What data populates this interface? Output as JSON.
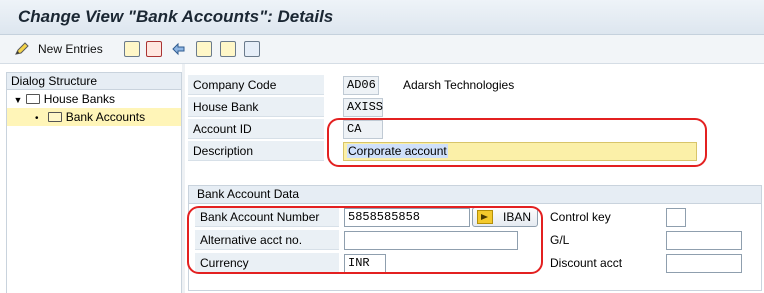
{
  "title": "Change View \"Bank Accounts\": Details",
  "toolbar": {
    "new_entries": "New Entries",
    "icons": [
      "edit-icon",
      "copy-icon",
      "delete-icon",
      "undo-icon",
      "select-all-icon",
      "select-block-icon",
      "deselect-all-icon"
    ]
  },
  "dialog_structure": {
    "header": "Dialog Structure",
    "items": [
      {
        "label": "House Banks",
        "expanded": true
      },
      {
        "label": "Bank Accounts",
        "selected": true
      }
    ]
  },
  "fields": {
    "company_code": {
      "label": "Company Code",
      "value": "AD06",
      "desc": "Adarsh Technologies"
    },
    "house_bank": {
      "label": "House Bank",
      "value": "AXISS"
    },
    "account_id": {
      "label": "Account ID",
      "value": "CA"
    },
    "description": {
      "label": "Description",
      "value": "Corporate account"
    }
  },
  "bank_account_data": {
    "title": "Bank Account Data",
    "bank_account_number": {
      "label": "Bank Account Number",
      "value": "5858585858"
    },
    "iban_button": "IBAN",
    "alt_acct_no": {
      "label": "Alternative acct no.",
      "value": ""
    },
    "currency": {
      "label": "Currency",
      "value": "INR"
    },
    "control_key": {
      "label": "Control key",
      "value": ""
    },
    "gl": {
      "label": "G/L",
      "value": ""
    },
    "discount_acct": {
      "label": "Discount acct",
      "value": ""
    }
  },
  "colors": {
    "highlight_frame": "#e32020",
    "focused_field": "#fbf0a8",
    "selected_tree_row": "#fff5b8"
  }
}
